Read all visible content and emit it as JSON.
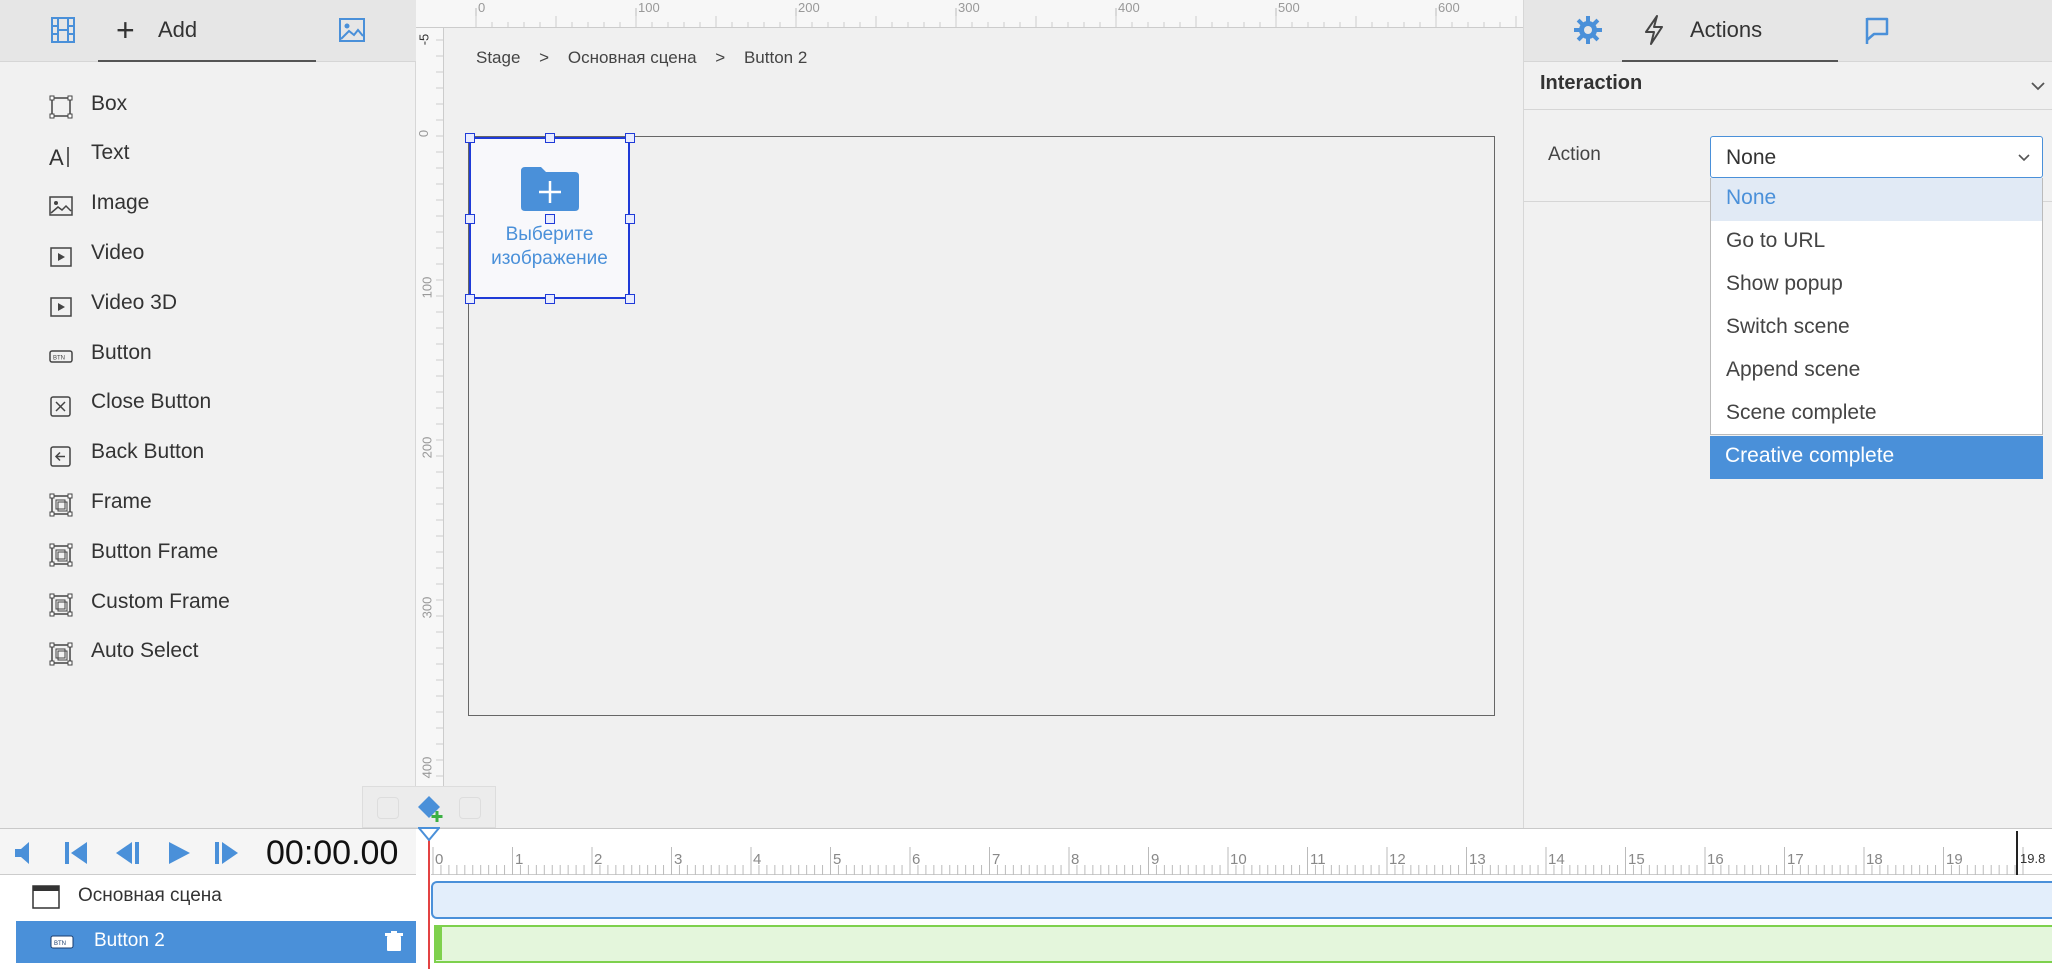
{
  "left_panel": {
    "add_label": "Add",
    "items": [
      {
        "label": "Box",
        "icon": "box-icon"
      },
      {
        "label": "Text",
        "icon": "text-icon"
      },
      {
        "label": "Image",
        "icon": "image-icon"
      },
      {
        "label": "Video",
        "icon": "video-icon"
      },
      {
        "label": "Video 3D",
        "icon": "video-3d-icon"
      },
      {
        "label": "Button",
        "icon": "button-icon"
      },
      {
        "label": "Close Button",
        "icon": "close-button-icon"
      },
      {
        "label": "Back Button",
        "icon": "back-button-icon"
      },
      {
        "label": "Frame",
        "icon": "frame-icon"
      },
      {
        "label": "Button Frame",
        "icon": "button-frame-icon"
      },
      {
        "label": "Custom Frame",
        "icon": "custom-frame-icon"
      },
      {
        "label": "Auto Select",
        "icon": "auto-select-icon"
      }
    ]
  },
  "canvas": {
    "ruler_top_labels": [
      "0",
      "100",
      "200",
      "300",
      "400",
      "500",
      "600"
    ],
    "ruler_left_labels": [
      "-5",
      "0",
      "100",
      "200",
      "300",
      "400"
    ],
    "breadcrumb": [
      "Stage",
      ">",
      "Основная сцена",
      ">",
      "Button 2"
    ],
    "placeholder_text": "Выберите изображение"
  },
  "right_panel": {
    "actions_label": "Actions",
    "section_title": "Interaction",
    "action_label": "Action",
    "action_value": "None",
    "options": [
      "None",
      "Go to URL",
      "Show popup",
      "Switch scene",
      "Append scene",
      "Scene complete",
      "Creative complete"
    ],
    "selected_option": "None",
    "hovered_option": "Creative complete"
  },
  "timeline": {
    "time": "00:00.00",
    "ticks": [
      "0",
      "1",
      "2",
      "3",
      "4",
      "5",
      "6",
      "7",
      "8",
      "9",
      "10",
      "11",
      "12",
      "13",
      "14",
      "15",
      "16",
      "17",
      "18",
      "19"
    ],
    "end_label": "19.8",
    "layers": [
      {
        "name": "Основная сцена",
        "icon": "scene-icon"
      },
      {
        "name": "Button 2",
        "icon": "button-icon"
      }
    ]
  },
  "colors": {
    "accent": "#4a90d9",
    "selection": "#1f3bd8",
    "track_green": "#7ed14d",
    "playhead": "#e34343"
  }
}
